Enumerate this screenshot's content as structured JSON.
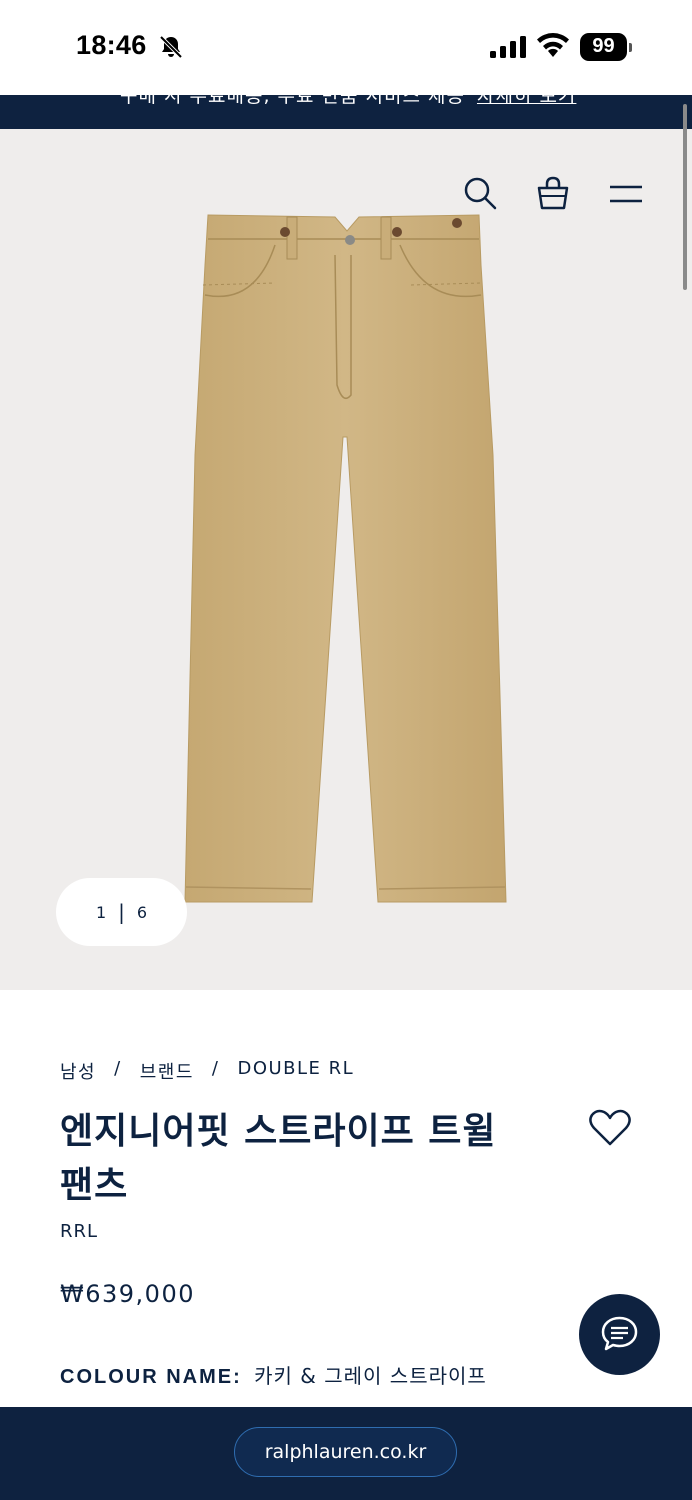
{
  "status_bar": {
    "time": "18:46",
    "battery": "99"
  },
  "promo": {
    "text": "구매 시 무료배송, 무료 반품 서비스 제공",
    "link": "자세히 보기"
  },
  "gallery": {
    "current_page": "1",
    "total_pages": "6",
    "separator": "|"
  },
  "breadcrumb": [
    {
      "label": "남성"
    },
    {
      "label": "브랜드"
    },
    {
      "label": "DOUBLE RL"
    }
  ],
  "breadcrumb_sep": "/",
  "product": {
    "title": "엔지니어핏 스트라이프 트윌 팬츠",
    "brand": "RRL",
    "price": "₩639,000",
    "colour_label": "COLOUR NAME:",
    "colour_value": "카키 & 그레이 스트라이프"
  },
  "browser": {
    "url": "ralphlauren.co.kr"
  },
  "colors": {
    "navy": "#0e2240",
    "image_bg": "#efedec",
    "khaki": "#c9ad7a"
  },
  "icons": [
    "bell-off-icon",
    "signal-icon",
    "wifi-icon",
    "battery-icon",
    "search-icon",
    "bag-icon",
    "menu-icon",
    "heart-icon",
    "chat-icon"
  ]
}
